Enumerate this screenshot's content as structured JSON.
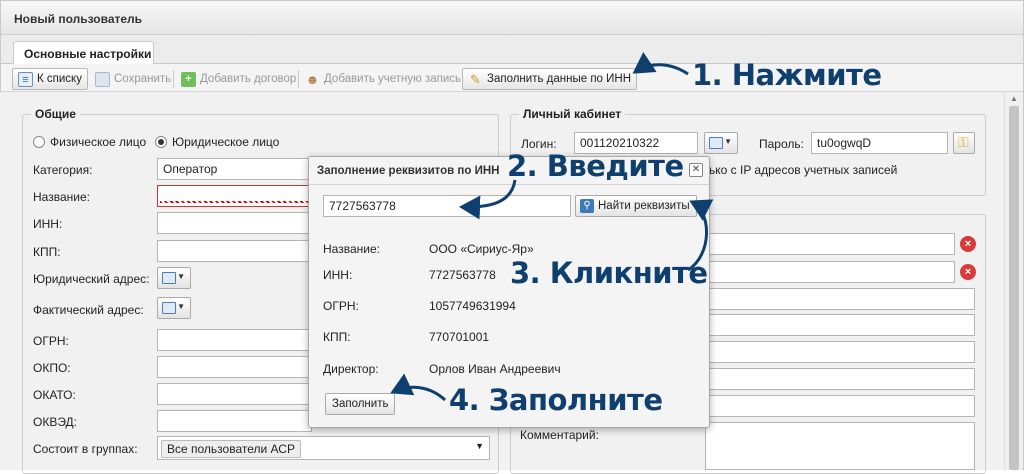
{
  "window": {
    "title": "Новый пользователь"
  },
  "tabs": [
    {
      "label": "Основные настройки"
    }
  ],
  "toolbar": {
    "to_list": "К списку",
    "save": "Сохранить",
    "add_contract": "Добавить договор",
    "add_account": "Добавить учетную запись",
    "fill_by_inn": "Заполнить данные по ИНН"
  },
  "general": {
    "legend": "Общие",
    "radio_physical": "Физическое лицо",
    "radio_legal": "Юридическое лицо",
    "category_label": "Категория:",
    "category_value": "Оператор",
    "name_label": "Название:",
    "inn_label": "ИНН:",
    "kpp_label": "КПП:",
    "legal_address_label": "Юридический адрес:",
    "actual_address_label": "Фактический адрес:",
    "ogrn_label": "ОГРН:",
    "okpo_label": "ОКПО:",
    "okato_label": "ОКАТО:",
    "okved_label": "ОКВЭД:",
    "groups_label": "Состоит в группах:",
    "groups_value": "Все пользователи АСР"
  },
  "cabinet": {
    "legend": "Личный кабинет",
    "login_label": "Логин:",
    "login_value": "001120210322",
    "password_label": "Пароль:",
    "password_value": "tu0ogwqD",
    "ip_note": "ько с IP адресов учетных записей",
    "comment_label": "Комментарий:"
  },
  "dialog": {
    "title": "Заполнение реквизитов по ИНН",
    "inn_input": "7727563778",
    "find_button": "Найти реквизиты",
    "name_label": "Название:",
    "name_value": "ООО «Сириус-Яр»",
    "inn_label": "ИНН:",
    "inn_value": "7727563778",
    "ogrn_label": "ОГРН:",
    "ogrn_value": "1057749631994",
    "kpp_label": "КПП:",
    "kpp_value": "770701001",
    "director_label": "Директор:",
    "director_value": "Орлов Иван Андреевич",
    "fill_button": "Заполнить"
  },
  "annotations": {
    "step1": "1. Нажмите",
    "step2": "2. Введите",
    "step3": "3. Кликните",
    "step4": "4. Заполните"
  },
  "colors": {
    "annotation": "#0f3f6e",
    "error": "#d93a3a",
    "key_icon": "#e0b020"
  },
  "icons": [
    "list-icon",
    "save-icon",
    "add-contract-icon",
    "add-account-icon",
    "wand-icon",
    "search-icon",
    "key-icon",
    "close-icon",
    "address-card-icon",
    "remove-icon"
  ]
}
